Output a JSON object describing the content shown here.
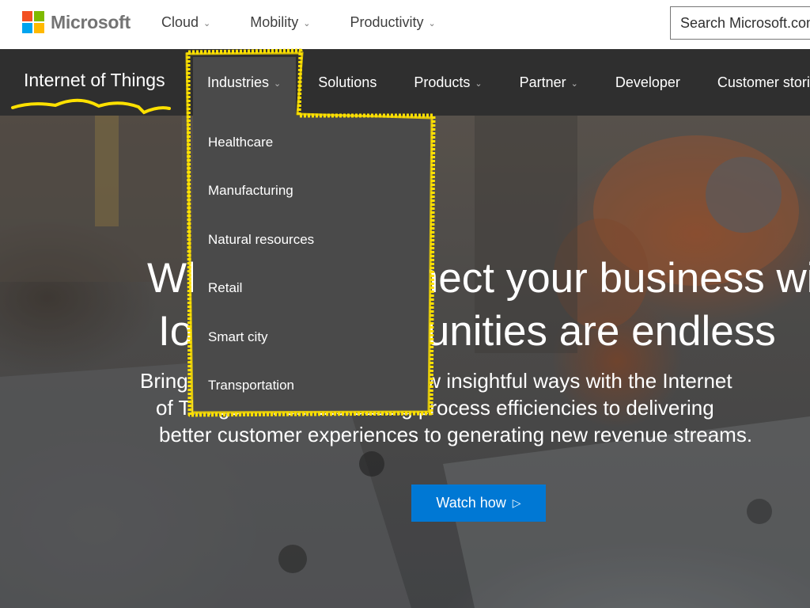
{
  "header": {
    "brand": "Microsoft",
    "brand_colors": [
      "#f25022",
      "#7fba00",
      "#00a4ef",
      "#ffb900"
    ],
    "nav": [
      {
        "label": "Cloud"
      },
      {
        "label": "Mobility"
      },
      {
        "label": "Productivity"
      }
    ],
    "search_placeholder": "Search Microsoft.com"
  },
  "subnav": {
    "title": "Internet of Things",
    "items": [
      {
        "label": "Industries",
        "has_dropdown": true,
        "active": true
      },
      {
        "label": "Solutions",
        "has_dropdown": false
      },
      {
        "label": "Products",
        "has_dropdown": true
      },
      {
        "label": "Partner",
        "has_dropdown": true
      },
      {
        "label": "Developer",
        "has_dropdown": false
      },
      {
        "label": "Customer stories",
        "has_dropdown": false
      }
    ]
  },
  "industries_dropdown": {
    "items": [
      "Healthcare",
      "Manufacturing",
      "Natural resources",
      "Retail",
      "Smart city",
      "Transportation"
    ]
  },
  "hero": {
    "headline_line1": "When you connect your business with",
    "headline_line2": "IoT, the opportunities are endless",
    "subtext_line1": "Bring your business to life in new insightful ways with the Internet",
    "subtext_line2": "of Things — from increasing process efficiencies to delivering",
    "subtext_line3": "better customer experiences to generating new revenue streams.",
    "cta_label": "Watch how",
    "cta_icon": "play-outline-icon",
    "cta_color": "#0078d4"
  },
  "annotation": {
    "color": "#ffe100",
    "type": "highlight-outline"
  },
  "colors": {
    "subnav_bg": "#2f2f2f",
    "dropdown_bg": "#4a4a4a"
  }
}
